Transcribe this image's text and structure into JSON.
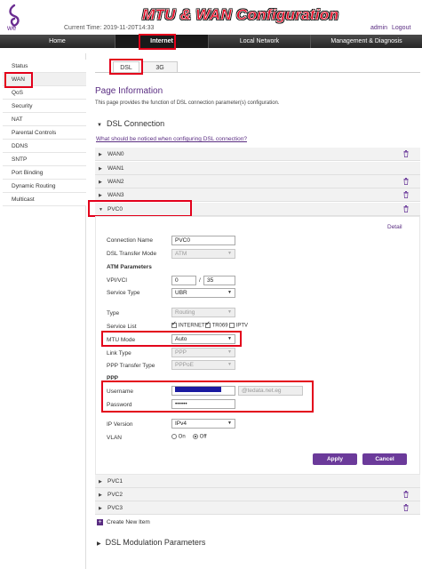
{
  "header": {
    "logo_text": "we",
    "current_time": "Current Time: 2019-11-20T14:33",
    "overlay_title": "MTU & WAN Configuration",
    "user": "admin",
    "logout": "Logout"
  },
  "nav": {
    "items": [
      "Home",
      "Internet",
      "Local Network",
      "Management & Diagnosis"
    ],
    "active": "Internet"
  },
  "sidebar": {
    "items": [
      "Status",
      "WAN",
      "QoS",
      "Security",
      "NAT",
      "Parental Controls",
      "DDNS",
      "SNTP",
      "Port Binding",
      "Dynamic Routing",
      "Multicast"
    ],
    "active": "WAN"
  },
  "tabs": [
    "DSL",
    "3G"
  ],
  "page_info": {
    "title": "Page Information",
    "text": "This page provides the function of DSL connection parameter(s) configuration."
  },
  "dsl_connection": {
    "title": "DSL Connection",
    "notice_link": "What should be noticed when configuring DSL connection?",
    "rows_top": [
      "WAN0",
      "WAN1",
      "WAN2",
      "WAN3"
    ],
    "expanded_row": "PVC0",
    "rows_bottom": [
      "PVC1",
      "PVC2",
      "PVC3"
    ],
    "create_new": "Create New Item"
  },
  "form": {
    "detail_link": "Detail",
    "connection_name_label": "Connection Name",
    "connection_name": "PVC0",
    "dsl_mode_label": "DSL Transfer Mode",
    "dsl_mode": "ATM",
    "atm_head": "ATM Parameters",
    "vpi_vci_label": "VPI/VCI",
    "vpi": "0",
    "vci_sep": "/",
    "vci": "35",
    "service_type_label": "Service Type",
    "service_type": "UBR",
    "type_label": "Type",
    "type": "Routing",
    "service_list_label": "Service List",
    "service_list": [
      "INTERNET",
      "TR069",
      "IPTV"
    ],
    "service_list_checked": [
      true,
      true,
      false
    ],
    "mtu_mode_label": "MTU Mode",
    "mtu_mode": "Auto",
    "link_type_label": "Link Type",
    "link_type": "PPP",
    "ppp_transfer_label": "PPP Transfer Type",
    "ppp_transfer": "PPPoE",
    "ppp_head": "PPP",
    "username_label": "Username",
    "username_suffix": "@tedata.net.eg",
    "password_label": "Password",
    "password": "••••••",
    "ip_version_label": "IP Version",
    "ip_version": "IPv4",
    "vlan_label": "VLAN",
    "vlan_on": "On",
    "vlan_off": "Off",
    "apply": "Apply",
    "cancel": "Cancel"
  },
  "dsl_modulation": {
    "title": "DSL Modulation Parameters"
  },
  "colors": {
    "accent": "#5a2d82",
    "highlight": "#e3001b",
    "nav_bg": "#2e2e2e"
  }
}
